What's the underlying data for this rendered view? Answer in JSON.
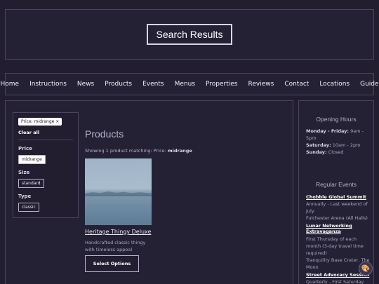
{
  "header": {
    "title": "Search Results"
  },
  "nav": {
    "items": [
      "Home",
      "Instructions",
      "News",
      "Products",
      "Events",
      "Menus",
      "Properties",
      "Reviews",
      "Contact",
      "Locations",
      "Guide"
    ]
  },
  "filters": {
    "active_chip": "Price: midrange ×",
    "clear_all": "Clear all",
    "price_label": "Price",
    "price_value": "midrange",
    "size_label": "Size",
    "size_value": "standard",
    "type_label": "Type",
    "type_value": "classic"
  },
  "products": {
    "title": "Products",
    "showing_prefix": "Showing 1 product matching: Price: ",
    "showing_value": "midrange",
    "item": {
      "name": "Heritage Thingy Deluxe",
      "description": "Handcrafted classic thingy with timeless appeal",
      "button": "Select Options"
    }
  },
  "sidebar": {
    "hours_title": "Opening Hours",
    "hours": [
      {
        "day": "Monday - Friday:",
        "time": " 9am - 5pm"
      },
      {
        "day": "Saturday:",
        "time": " 10am - 2pm"
      },
      {
        "day": "Sunday:",
        "time": " Closed"
      }
    ],
    "events_title": "Regular Events",
    "events": [
      {
        "title": "Chobble Global Summit",
        "meta": "Annually - Last weekend of July\nFulchester Arena (All Halls)"
      },
      {
        "title": "Lunar Networking Extravaganza",
        "meta": "First Thursday of each month (3-day travel time required)\nTranquility Base Crater, The Moon"
      },
      {
        "title": "Street Advocacy Session",
        "meta": "Quarterly - First Saturday"
      }
    ]
  },
  "fab": {
    "icon": "palette-icon"
  }
}
